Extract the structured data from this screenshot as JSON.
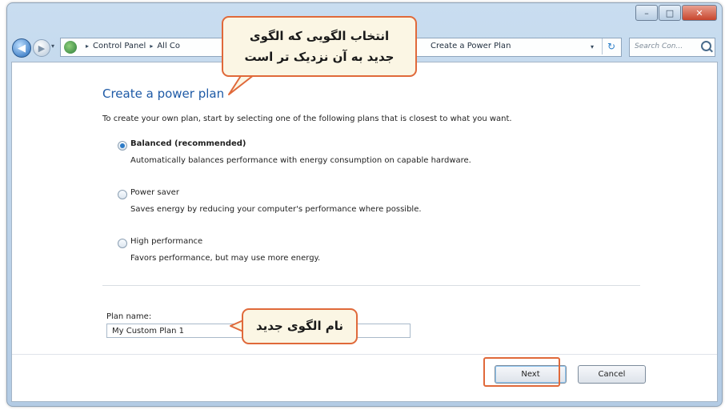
{
  "window": {
    "caption_buttons": {
      "minimize": "–",
      "maximize": "□",
      "close": "✕"
    }
  },
  "navigation": {
    "back_glyph": "◀",
    "forward_glyph": "▶",
    "recent_glyph": "▾",
    "breadcrumb": [
      "Control Panel",
      "All Co"
    ],
    "breadcrumb_separator": "▸",
    "current_page": "Create a Power Plan",
    "dropdown_glyph": "▾",
    "refresh_glyph": "↻",
    "search_placeholder": "Search Con..."
  },
  "page": {
    "title": "Create a power plan",
    "instructions": "To create your own plan, start by selecting one of the following plans that is closest to what you want."
  },
  "plans": [
    {
      "title": "Balanced (recommended)",
      "description": "Automatically balances performance with energy consumption on capable hardware.",
      "selected": true
    },
    {
      "title": "Power saver",
      "description": "Saves energy by reducing your computer's performance where possible.",
      "selected": false
    },
    {
      "title": "High performance",
      "description": "Favors performance, but may use more energy.",
      "selected": false
    }
  ],
  "plan_name": {
    "label": "Plan name:",
    "value": "My Custom Plan 1"
  },
  "buttons": {
    "next": "Next",
    "cancel": "Cancel"
  },
  "annotations": {
    "select_plan_line1": "انتخاب الگویی که الگوی",
    "select_plan_line2": "جدید به آن نزدیک تر است",
    "new_plan_name": "نام الگوی جدید",
    "accent_color": "#e0693a"
  }
}
